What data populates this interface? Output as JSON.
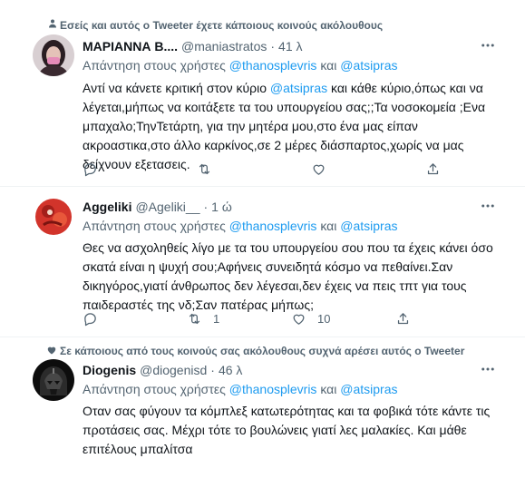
{
  "tweets": [
    {
      "context": "Εσείς και αυτός ο Tweeter έχετε κάποιους κοινούς ακόλουθους",
      "context_icon": "people-icon",
      "name": "ΜΑΡΙΑΝΝΑ Β....",
      "handle": "@maniastratos",
      "dot": "·",
      "time": "41 λ",
      "reply_prefix": "Απάντηση στους χρήστες",
      "mention1": "@thanosplevris",
      "reply_and": "και",
      "mention2": "@atsipras",
      "text_lines": [
        "Αντί να κάνετε κριτική στον κύριο @atsipras και κάθε κύριο,όπως και να",
        "λέγεται,μήπως να κοιτάξετε τα του υπουργείου σας;;Τα νοσοκομεία ;Ενα",
        "μπαχαλο;ΤηνΤετάρτη, για την μητέρα μου,στο ένα μας είπαν",
        "ακροαστικα,στο άλλο καρκίνος,σε 2 μέρες διάσπαρτος,χωρίς να μας",
        "δείχνουν εξετασεις."
      ],
      "reply_count": "",
      "retweet_count": "",
      "like_count": ""
    },
    {
      "context": "",
      "name": "Aggeliki",
      "handle": "@Ageliki__",
      "dot": "·",
      "time": "1 ώ",
      "reply_prefix": "Απάντηση στους χρήστες",
      "mention1": "@thanosplevris",
      "reply_and": "και",
      "mention2": "@atsipras",
      "text_lines": [
        "Θες να ασχοληθείς λίγο με τα του υπουργείου σου που τα έχεις κάνει όσο",
        "σκατά είναι η ψυχή σου;Αφήνεις συνειδητά κόσμο να πεθαίνει.Σαν",
        "δικηγόρος,γιατί άνθρωπος δεν λέγεσαι,δεν έχεις να πεις τπτ για τους",
        "παιδεραστές της νδ;Σαν πατέρας μήπως;"
      ],
      "reply_count": "",
      "retweet_count": "1",
      "like_count": "10"
    },
    {
      "context": "Σε κάποιους από τους κοινούς σας ακόλουθους συχνά αρέσει αυτός ο Tweeter",
      "context_icon": "heart-icon",
      "name": "Diogenis",
      "handle": "@diogenisd",
      "dot": "·",
      "time": "46 λ",
      "reply_prefix": "Απάντηση στους χρήστες",
      "mention1": "@thanosplevris",
      "reply_and": "και",
      "mention2": "@atsipras",
      "text_lines": [
        "Οταν σας φύγουν τα κόμπλεξ κατωτερότητας και τα φοβικά τότε κάντε τις",
        "προτάσεις σας. Μέχρι τότε το βουλώνεις γιατί λες μαλακίες. Και μάθε",
        "επιτέλους μπαλίτσα"
      ]
    }
  ],
  "colors": {
    "link": "#1d9bf0",
    "secondary_text": "#536471",
    "primary_text": "#0f1419",
    "divider": "#eff3f4"
  }
}
